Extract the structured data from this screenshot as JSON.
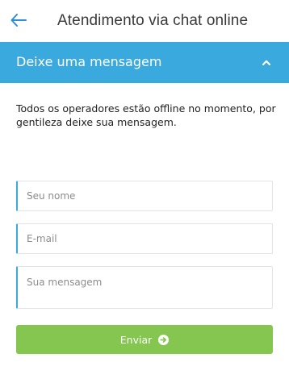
{
  "header": {
    "back_icon": "arrow-left-icon",
    "title": "Atendimento via chat online"
  },
  "panel": {
    "title": "Deixe uma mensagem",
    "collapse_icon": "chevron-up-icon",
    "accent_color": "#3aa9de"
  },
  "form": {
    "intro_text": "Todos os operadores estão offline no momento, por gentileza deixe sua mensagem.",
    "name": {
      "placeholder": "Seu nome",
      "value": ""
    },
    "email": {
      "placeholder": "E-mail",
      "value": ""
    },
    "message": {
      "placeholder": "Sua mensagem",
      "value": ""
    },
    "submit": {
      "label": "Enviar",
      "icon": "arrow-right-circle-icon",
      "color": "#84c650"
    }
  }
}
